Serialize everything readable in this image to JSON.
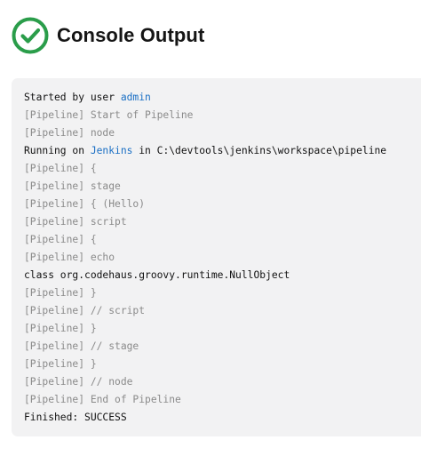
{
  "header": {
    "icon": "check-circle-icon",
    "title": "Console Output",
    "success_color": "#2a9d4a"
  },
  "console": {
    "lines": [
      {
        "style": "plain",
        "prefix": "Started by user ",
        "link": "admin",
        "suffix": ""
      },
      {
        "style": "dim",
        "text": "[Pipeline] Start of Pipeline"
      },
      {
        "style": "dim",
        "text": "[Pipeline] node"
      },
      {
        "style": "plain",
        "prefix": "Running on ",
        "link": "Jenkins",
        "suffix": " in C:\\devtools\\jenkins\\workspace\\pipeline"
      },
      {
        "style": "dim",
        "text": "[Pipeline] {"
      },
      {
        "style": "dim",
        "text": "[Pipeline] stage"
      },
      {
        "style": "dim",
        "text": "[Pipeline] { (Hello)"
      },
      {
        "style": "dim",
        "text": "[Pipeline] script"
      },
      {
        "style": "dim",
        "text": "[Pipeline] {"
      },
      {
        "style": "dim",
        "text": "[Pipeline] echo"
      },
      {
        "style": "plain",
        "text": "class org.codehaus.groovy.runtime.NullObject"
      },
      {
        "style": "dim",
        "text": "[Pipeline] }"
      },
      {
        "style": "dim",
        "text": "[Pipeline] // script"
      },
      {
        "style": "dim",
        "text": "[Pipeline] }"
      },
      {
        "style": "dim",
        "text": "[Pipeline] // stage"
      },
      {
        "style": "dim",
        "text": "[Pipeline] }"
      },
      {
        "style": "dim",
        "text": "[Pipeline] // node"
      },
      {
        "style": "dim",
        "text": "[Pipeline] End of Pipeline"
      },
      {
        "style": "plain",
        "text": "Finished: SUCCESS"
      }
    ]
  }
}
